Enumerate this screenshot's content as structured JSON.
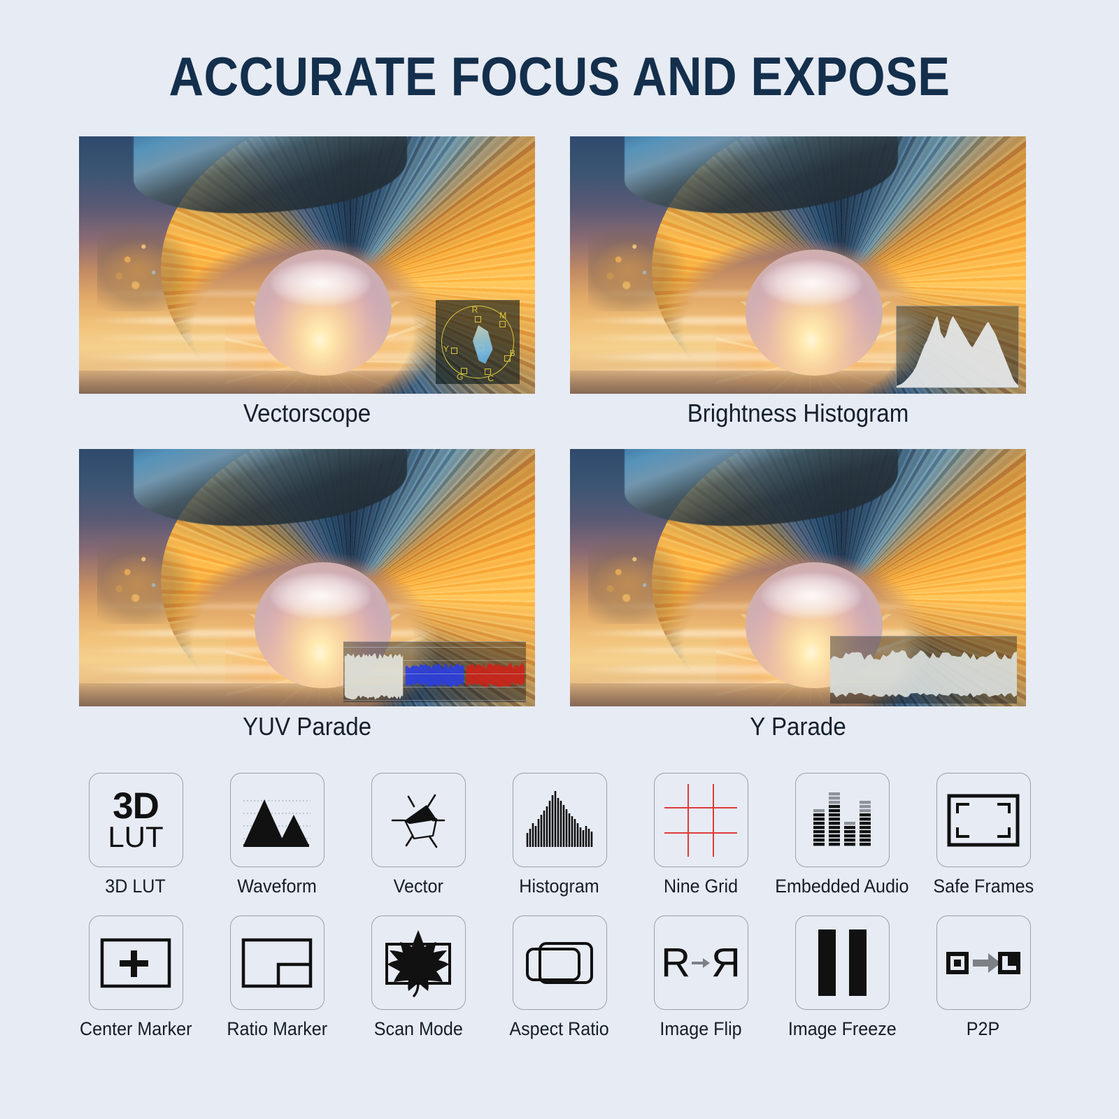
{
  "header": {
    "title": "ACCURATE FOCUS AND EXPOSE",
    "title_color": "#132f4c"
  },
  "theme": {
    "background": "#e7ebf3",
    "icon_border": "#9aa2ab",
    "icon_ink": "#111111",
    "nine_grid_red": "#e03b3b",
    "vectorscope_yellow": "#d9c73a",
    "caption_color": "#15202c"
  },
  "panels": [
    {
      "id": "vectorscope",
      "caption": "Vectorscope",
      "overlay_type": "vectorscope",
      "overlay": {
        "targets": [
          "R",
          "M",
          "B",
          "C",
          "G",
          "Y"
        ],
        "ring_color": "#d9c73a",
        "trace_color": "#7ec0e6"
      }
    },
    {
      "id": "brightness-histogram",
      "caption": "Brightness Histogram",
      "overlay_type": "histogram",
      "overlay": {
        "fill_color": "#e8eaec",
        "bins": [
          2,
          3,
          4,
          5,
          7,
          9,
          12,
          14,
          17,
          20,
          24,
          28,
          34,
          40,
          46,
          52,
          58,
          62,
          68,
          74,
          80,
          86,
          92,
          96,
          88,
          74,
          70,
          66,
          70,
          78,
          86,
          92,
          96,
          92,
          88,
          84,
          80,
          76,
          72,
          68,
          64,
          60,
          56,
          54,
          58,
          62,
          66,
          70,
          74,
          78,
          82,
          86,
          88,
          84,
          80,
          76,
          72,
          66,
          60,
          54,
          48,
          42,
          36,
          30,
          24,
          18,
          12,
          8,
          5,
          3
        ]
      }
    },
    {
      "id": "yuv-parade",
      "caption": "YUV Parade",
      "overlay_type": "parade",
      "overlay": {
        "channels": [
          {
            "name": "Y",
            "color": "#e4e6dd"
          },
          {
            "name": "U",
            "color": "#2b3ee0"
          },
          {
            "name": "V",
            "color": "#cc2418"
          }
        ],
        "gridlines": 5
      }
    },
    {
      "id": "y-parade",
      "caption": "Y Parade",
      "overlay_type": "yparade",
      "overlay": {
        "channels": [
          {
            "name": "Y",
            "color": "#dfe5e2"
          }
        ],
        "gridlines": 4
      }
    }
  ],
  "features": {
    "rows": [
      [
        {
          "label": "3D LUT",
          "icon": "3d-lut-icon",
          "icon_text_top": "3D",
          "icon_text_bottom": "LUT"
        },
        {
          "label": "Waveform",
          "icon": "waveform-icon"
        },
        {
          "label": "Vector",
          "icon": "vector-icon"
        },
        {
          "label": "Histogram",
          "icon": "histogram-icon"
        },
        {
          "label": "Nine Grid",
          "icon": "nine-grid-icon"
        },
        {
          "label": "Embedded Audio",
          "icon": "embedded-audio-icon"
        },
        {
          "label": "Safe Frames",
          "icon": "safe-frames-icon"
        }
      ],
      [
        {
          "label": "Center Marker",
          "icon": "center-marker-icon"
        },
        {
          "label": "Ratio Marker",
          "icon": "ratio-marker-icon"
        },
        {
          "label": "Scan Mode",
          "icon": "scan-mode-icon"
        },
        {
          "label": "Aspect Ratio",
          "icon": "aspect-ratio-icon"
        },
        {
          "label": "Image Flip",
          "icon": "image-flip-icon",
          "glyph_left": "R",
          "glyph_right": "R"
        },
        {
          "label": "Image Freeze",
          "icon": "image-freeze-icon"
        },
        {
          "label": "P2P",
          "icon": "p2p-icon"
        }
      ]
    ]
  }
}
